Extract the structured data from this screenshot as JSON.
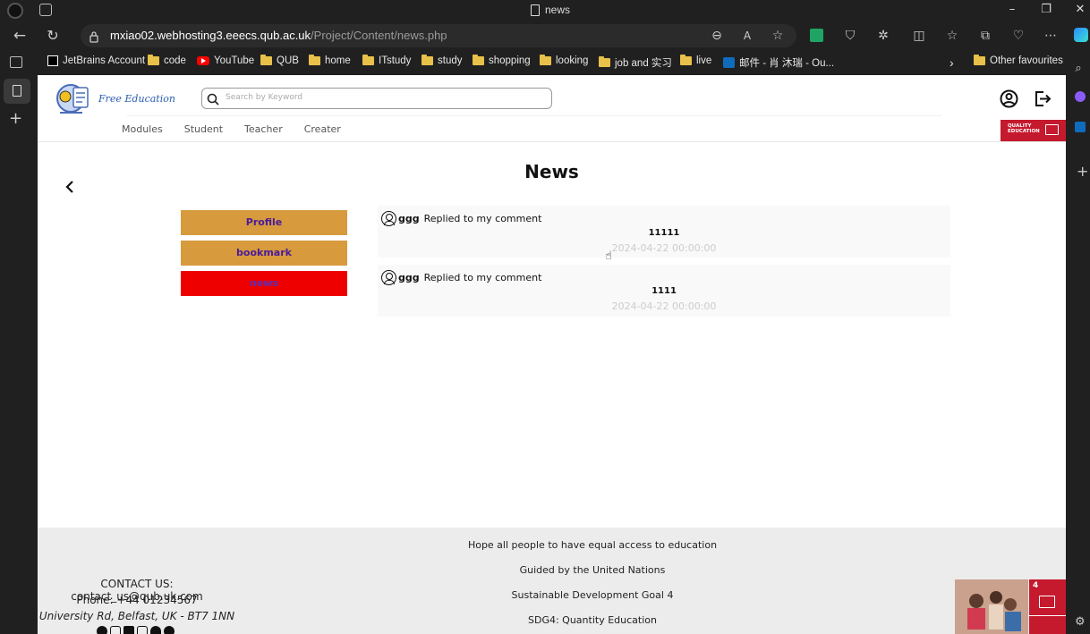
{
  "browser": {
    "tab_title": "news",
    "url_host": "mxiao02.webhosting3.eeecs.qub.ac.uk",
    "url_path": "/Project/Content/news.php",
    "bookmarks": [
      {
        "label": "JetBrains Account",
        "icon": "jetbrains-icon"
      },
      {
        "label": "code",
        "icon": "folder-icon"
      },
      {
        "label": "YouTube",
        "icon": "youtube-icon"
      },
      {
        "label": "QUB",
        "icon": "folder-icon"
      },
      {
        "label": "home",
        "icon": "folder-icon"
      },
      {
        "label": "ITstudy",
        "icon": "folder-icon"
      },
      {
        "label": "study",
        "icon": "folder-icon"
      },
      {
        "label": "shopping",
        "icon": "folder-icon"
      },
      {
        "label": "looking",
        "icon": "folder-icon"
      },
      {
        "label": "job and 实习",
        "icon": "folder-icon"
      },
      {
        "label": "live",
        "icon": "folder-icon"
      },
      {
        "label": "邮件 - 肖 沐瑞 - Ou...",
        "icon": "outlook-icon"
      }
    ],
    "other_favourites": "Other favourites"
  },
  "site": {
    "logo_text": "Free Education",
    "search_placeholder": "Search by Keyword",
    "nav": [
      "Modules",
      "Student",
      "Teacher",
      "Creater"
    ],
    "quality_badge": "QUALITY EDUCATION"
  },
  "main": {
    "title": "News",
    "menu": [
      {
        "label": "Profile",
        "bg": "#d79a3c",
        "color": "#4a1a9c"
      },
      {
        "label": "bookmark",
        "bg": "#d79a3c",
        "color": "#4a1a9c"
      },
      {
        "label": "news",
        "bg": "#ee0000",
        "color": "#5b2db8"
      }
    ],
    "news": [
      {
        "user": "ggg",
        "action": "Replied to my comment",
        "content": "11111",
        "time": "2024-04-22 00:00:00"
      },
      {
        "user": "ggg",
        "action": "Replied to my comment",
        "content": "1111",
        "time": "2024-04-22 00:00:00"
      }
    ]
  },
  "footer": {
    "center": [
      "Hope all people to have equal access to education",
      "Guided by the United Nations",
      "Sustainable Development Goal 4",
      "SDG4: Quantity Education"
    ],
    "contact_label": "CONTACT US:",
    "contact_email": "contact_us@qub.uk.com",
    "phone": "Phone: +44 01234567",
    "address": "University Rd, Belfast, UK - BT7 1NN"
  }
}
